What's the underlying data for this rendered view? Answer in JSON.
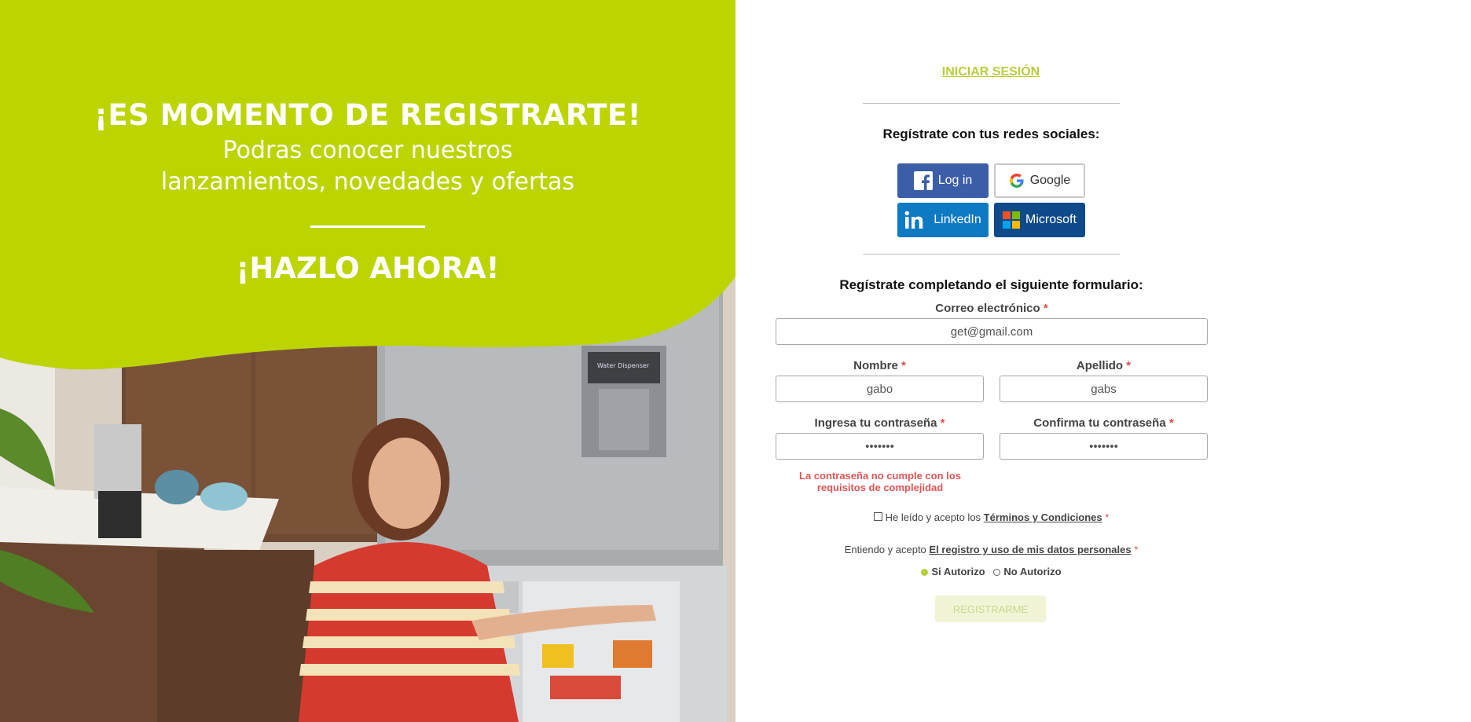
{
  "hero": {
    "title": "¡ES MOMENTO DE REGISTRARTE!",
    "subtitle_line1": "Podras conocer nuestros",
    "subtitle_line2": "lanzamientos, novedades y ofertas",
    "cta": "¡HAZLO AHORA!",
    "dispenser_label": "Water Dispenser"
  },
  "login_link": "INICIAR SESIÓN",
  "social": {
    "title": "Regístrate con tus redes sociales:",
    "facebook_label": "Log in",
    "google_label": "Google",
    "linkedin_label": "LinkedIn",
    "microsoft_label": "Microsoft"
  },
  "form": {
    "title": "Regístrate completando el siguiente formulario:",
    "required_mark": "*",
    "email_label": "Correo electrónico",
    "email_value": "get@gmail.com",
    "first_name_label": "Nombre",
    "first_name_value": "gabo",
    "last_name_label": "Apellido",
    "last_name_value": "gabs",
    "password_label": "Ingresa tu contraseña",
    "password_value": "•••••••",
    "confirm_label": "Confirma tu contraseña",
    "confirm_value": "•••••••",
    "password_error": "La contraseña no cumple con los requisitos de complejidad",
    "terms_prefix": "He leído y acepto los",
    "terms_link": "Términos y Condiciones",
    "data_prefix": "Entiendo y acepto",
    "data_link": "El registro y uso de mis datos personales",
    "authorize_yes": "Si Autorizo",
    "authorize_no": "No Autorizo",
    "submit_label": "REGISTRARME"
  },
  "colors": {
    "brand_green": "#bcd400",
    "link_green": "#b5cf3b",
    "error_red": "#e05555",
    "facebook": "#3b5ea8",
    "linkedin": "#0e7ac4",
    "microsoft": "#0f4a8a"
  }
}
